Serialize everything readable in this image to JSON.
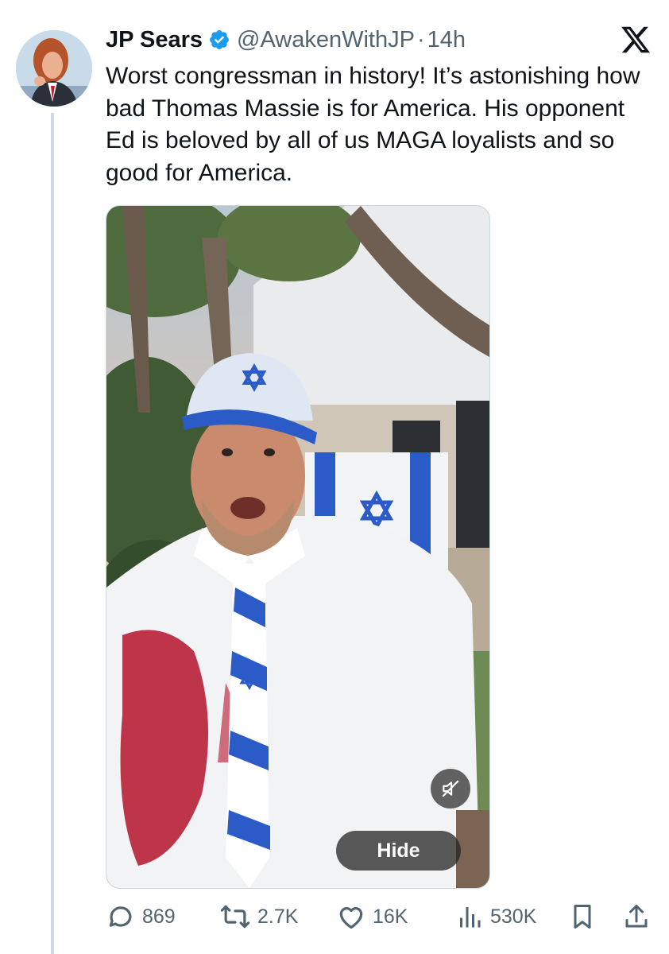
{
  "tweet": {
    "author_name": "JP Sears",
    "handle": "@AwakenWithJP",
    "separator": "·",
    "time": "14h",
    "text": "Worst congressman in history! It’s astonishing how bad Thomas Massie is for America. His opponent Ed is beloved by all of us MAGA loyalists and so good for America.",
    "verified": true
  },
  "media": {
    "type": "video",
    "hide_label": "Hide",
    "mute_icon": "speaker-muted-icon",
    "muted": true
  },
  "actions": {
    "replies": "869",
    "reposts": "2.7K",
    "likes": "16K",
    "views": "530K"
  },
  "icons": {
    "close": "x-logo-icon",
    "reply": "speech-bubble-icon",
    "repost": "repost-arrows-icon",
    "like": "heart-icon",
    "views": "bar-chart-icon",
    "bookmark": "bookmark-icon",
    "share": "share-upload-icon"
  },
  "colors": {
    "verified_blue": "#1d9bf0",
    "text_primary": "#0f1419",
    "text_secondary": "#536471",
    "thread_line": "#cfd9de"
  }
}
